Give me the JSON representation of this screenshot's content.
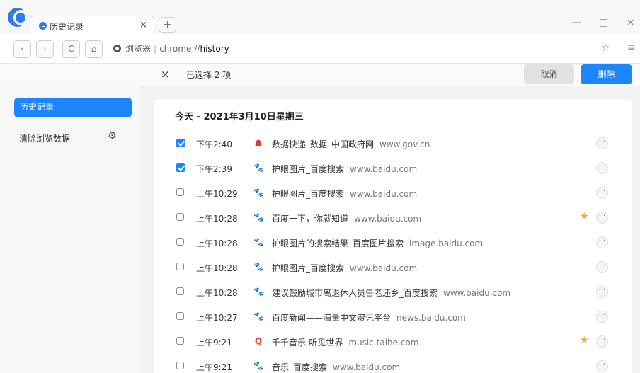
{
  "tab": {
    "title": "历史记录",
    "close": "×",
    "new_tab": "+"
  },
  "window": {
    "minimize": "—",
    "maximize": "□",
    "close": "×"
  },
  "nav": {
    "back": "‹",
    "forward": "›",
    "reload": "C",
    "home": "⌂",
    "site_label": "浏览器",
    "url_protocol": "chrome://",
    "url_host": "history",
    "bookmark": "☆",
    "menu": "≡"
  },
  "selection": {
    "close": "×",
    "count_label": "已选择 2 项",
    "cancel": "取消",
    "delete": "删除"
  },
  "sidebar": {
    "history": "历史记录",
    "clear": "清除浏览数据",
    "gear": "⚙"
  },
  "day_title": "今天 - 2021年3月10日星期三",
  "rows": [
    {
      "checked": true,
      "time": "下午2:40",
      "icon": "gov",
      "title": "数据快递_数据_中国政府网",
      "domain": "www.gov.cn",
      "starred": false
    },
    {
      "checked": true,
      "time": "下午2:39",
      "icon": "baidu",
      "title": "护眼图片_百度搜索",
      "domain": "www.baidu.com",
      "starred": false
    },
    {
      "checked": false,
      "time": "上午10:29",
      "icon": "baidu",
      "title": "护眼图片_百度搜索",
      "domain": "www.baidu.com",
      "starred": false
    },
    {
      "checked": false,
      "time": "上午10:28",
      "icon": "baidu",
      "title": "百度一下，你就知道",
      "domain": "www.baidu.com",
      "starred": true
    },
    {
      "checked": false,
      "time": "上午10:28",
      "icon": "baidu",
      "title": "护眼图片的搜索结果_百度图片搜索",
      "domain": "image.baidu.com",
      "starred": false
    },
    {
      "checked": false,
      "time": "上午10:28",
      "icon": "baidu",
      "title": "护眼图片_百度搜索",
      "domain": "www.baidu.com",
      "starred": false
    },
    {
      "checked": false,
      "time": "上午10:28",
      "icon": "baidu",
      "title": "建议鼓励城市离退休人员告老还乡_百度搜索",
      "domain": "www.baidu.com",
      "starred": false
    },
    {
      "checked": false,
      "time": "上午10:27",
      "icon": "baidu",
      "title": "百度新闻——海量中文资讯平台",
      "domain": "news.baidu.com",
      "starred": false
    },
    {
      "checked": false,
      "time": "上午9:21",
      "icon": "qianqian",
      "title": "千千音乐-听见世界",
      "domain": "music.taihe.com",
      "starred": true
    },
    {
      "checked": false,
      "time": "上午9:21",
      "icon": "baidu",
      "title": "音乐_百度搜索",
      "domain": "www.baidu.com",
      "starred": false
    }
  ],
  "icons": {
    "baidu": "🐾",
    "gov": "☗",
    "qianqian": "Q",
    "star": "★",
    "more": "···"
  },
  "colors": {
    "accent": "#1b86ff",
    "star": "#f5a623"
  }
}
